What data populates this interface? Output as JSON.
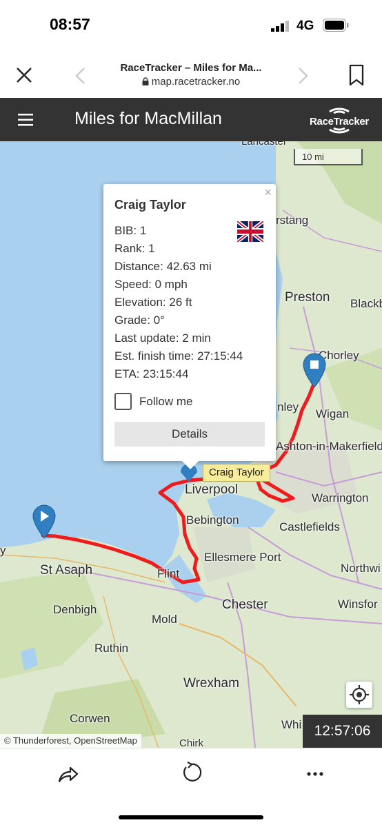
{
  "status": {
    "time": "08:57",
    "network": "4G"
  },
  "browser": {
    "title": "RaceTracker – Miles for Ma...",
    "url": "map.racetracker.no",
    "icons": [
      "close-icon",
      "back-arrow-icon",
      "forward-arrow-icon",
      "bookmark-icon",
      "lock-icon"
    ]
  },
  "app": {
    "title": "Miles for MacMillan",
    "logo_text": "RaceTracker",
    "icons": [
      "hamburger-menu-icon",
      "racetracker-logo"
    ]
  },
  "map": {
    "scale": "10 mi",
    "places": {
      "lancaster": "Lancaster",
      "garstang": "rstang",
      "preston": "Preston",
      "blackburn": "Blackb",
      "chorley": "Chorley",
      "wigan": "Wigan",
      "ormskirk": "nley",
      "ashton": "Ashton-in-Makerfield",
      "liverpool": "Liverpool",
      "warrington": "Warrington",
      "bebington": "Bebington",
      "castlefields": "Castlefields",
      "ellesmere": "Ellesmere Port",
      "northwich": "Northwi",
      "st_asaph": "St Asaph",
      "flint": "Flint",
      "chester": "Chester",
      "winsford": "Winsfor",
      "denbigh": "Denbigh",
      "mold": "Mold",
      "ruthin": "Ruthin",
      "wrexham": "Wrexham",
      "corwen": "Corwen",
      "whitchurch": "Whi",
      "chirk": "Chirk",
      "rhyl_fragment": "y"
    },
    "popup": {
      "name": "Craig Taylor",
      "close": "×",
      "lines": [
        "BIB: 1",
        "Rank: 1",
        "Distance: 42.63 mi",
        "Speed: 0 mph",
        "Elevation: 26 ft",
        "Grade: 0°",
        "Last update: 2 min",
        "Est. finish time: 27:15:44",
        "ETA: 23:15:44"
      ],
      "follow_label": "Follow me",
      "details_label": "Details",
      "flag": "uk-flag"
    },
    "tooltip": "Craig Taylor",
    "attribution": "© Thunderforest, OpenStreetMap",
    "clock": "12:57:06",
    "colors": {
      "route": "#ee1c1c",
      "marker": "#2f7fc1",
      "sea": "#a9d0ee",
      "land": "#dde8cf"
    }
  },
  "toolbar": {
    "icons": [
      "share-icon",
      "reload-icon",
      "more-icon"
    ]
  }
}
